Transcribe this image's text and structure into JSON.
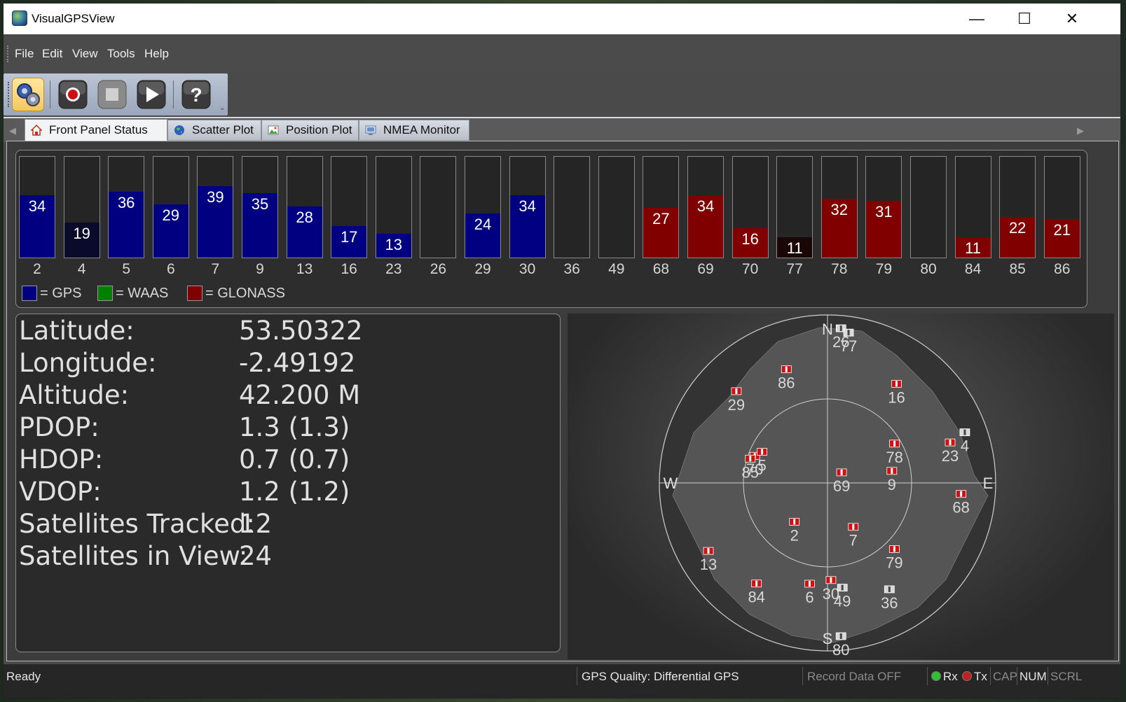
{
  "window": {
    "title": "VisualGPSView",
    "minimize": "—",
    "maximize": "☐",
    "close": "✕"
  },
  "menu": [
    "File",
    "Edit",
    "View",
    "Tools",
    "Help"
  ],
  "toolbar": {
    "settings": "settings",
    "record": "record",
    "stop": "stop",
    "play": "play",
    "help": "?"
  },
  "tabs": [
    {
      "label": "Front Panel Status",
      "icon": "home-icon"
    },
    {
      "label": "Scatter Plot",
      "icon": "globe-icon"
    },
    {
      "label": "Position Plot",
      "icon": "picture-icon"
    },
    {
      "label": "NMEA Monitor",
      "icon": "monitor-icon"
    }
  ],
  "colors": {
    "gps": "#000080",
    "waas": "#008000",
    "glonass": "#800000",
    "gps_weak": "#0a0a2a",
    "glonass_weak": "#1a0606"
  },
  "snr": {
    "scale_max": 55,
    "bars": [
      {
        "prn": "2",
        "snr": 34,
        "system": "gps"
      },
      {
        "prn": "4",
        "snr": 19,
        "system": "gps_weak"
      },
      {
        "prn": "5",
        "snr": 36,
        "system": "gps"
      },
      {
        "prn": "6",
        "snr": 29,
        "system": "gps"
      },
      {
        "prn": "7",
        "snr": 39,
        "system": "gps"
      },
      {
        "prn": "9",
        "snr": 35,
        "system": "gps"
      },
      {
        "prn": "13",
        "snr": 28,
        "system": "gps"
      },
      {
        "prn": "16",
        "snr": 17,
        "system": "gps"
      },
      {
        "prn": "23",
        "snr": 13,
        "system": "gps"
      },
      {
        "prn": "26",
        "snr": null,
        "system": "none"
      },
      {
        "prn": "29",
        "snr": 24,
        "system": "gps"
      },
      {
        "prn": "30",
        "snr": 34,
        "system": "gps"
      },
      {
        "prn": "36",
        "snr": null,
        "system": "none"
      },
      {
        "prn": "49",
        "snr": null,
        "system": "none"
      },
      {
        "prn": "68",
        "snr": 27,
        "system": "glonass"
      },
      {
        "prn": "69",
        "snr": 34,
        "system": "glonass"
      },
      {
        "prn": "70",
        "snr": 16,
        "system": "glonass"
      },
      {
        "prn": "77",
        "snr": 11,
        "system": "glonass_weak"
      },
      {
        "prn": "78",
        "snr": 32,
        "system": "glonass"
      },
      {
        "prn": "79",
        "snr": 31,
        "system": "glonass"
      },
      {
        "prn": "80",
        "snr": null,
        "system": "none"
      },
      {
        "prn": "84",
        "snr": 11,
        "system": "glonass"
      },
      {
        "prn": "85",
        "snr": 22,
        "system": "glonass"
      },
      {
        "prn": "86",
        "snr": 21,
        "system": "glonass"
      }
    ],
    "legend": [
      {
        "label": "= GPS",
        "color": "#000080"
      },
      {
        "label": "= WAAS",
        "color": "#008000"
      },
      {
        "label": "= GLONASS",
        "color": "#800000"
      }
    ]
  },
  "info": [
    {
      "label": "Latitude:",
      "value": "53.50322"
    },
    {
      "label": "Longitude:",
      "value": "-2.49192"
    },
    {
      "label": "Altitude:",
      "value": "42.200 M"
    },
    {
      "label": "PDOP:",
      "value": "1.3 (1.3)"
    },
    {
      "label": "HDOP:",
      "value": "0.7 (0.7)"
    },
    {
      "label": "VDOP:",
      "value": "1.2 (1.2)"
    },
    {
      "label": "Satellites Tracked:",
      "value": "12"
    },
    {
      "label": "Satellites in View:",
      "value": "24"
    }
  ],
  "skyplot": {
    "directions": {
      "n": "N",
      "s": "S",
      "e": "E",
      "w": "W"
    },
    "satellites": [
      {
        "prn": "26",
        "az": 5,
        "el": 0,
        "used": false
      },
      {
        "prn": "77",
        "az": 8,
        "el": 2,
        "used": false
      },
      {
        "prn": "86",
        "az": 340,
        "el": 20,
        "used": true
      },
      {
        "prn": "16",
        "az": 35,
        "el": 20,
        "used": true
      },
      {
        "prn": "29",
        "az": 315,
        "el": 15,
        "used": true
      },
      {
        "prn": "78",
        "az": 60,
        "el": 45,
        "used": true
      },
      {
        "prn": "4",
        "az": 70,
        "el": 5,
        "used": false
      },
      {
        "prn": "23",
        "az": 72,
        "el": 15,
        "used": true
      },
      {
        "prn": "70",
        "az": 290,
        "el": 45,
        "used": true
      },
      {
        "prn": "5",
        "az": 295,
        "el": 48,
        "used": true
      },
      {
        "prn": "85",
        "az": 287,
        "el": 43,
        "used": true
      },
      {
        "prn": "69",
        "az": 55,
        "el": 80,
        "used": true
      },
      {
        "prn": "9",
        "az": 80,
        "el": 52,
        "used": true
      },
      {
        "prn": "68",
        "az": 95,
        "el": 12,
        "used": true
      },
      {
        "prn": "2",
        "az": 220,
        "el": 60,
        "used": true
      },
      {
        "prn": "7",
        "az": 150,
        "el": 60,
        "used": true
      },
      {
        "prn": "79",
        "az": 135,
        "el": 35,
        "used": true
      },
      {
        "prn": "13",
        "az": 240,
        "el": 10,
        "used": true
      },
      {
        "prn": "84",
        "az": 215,
        "el": 18,
        "used": true
      },
      {
        "prn": "6",
        "az": 190,
        "el": 30,
        "used": true
      },
      {
        "prn": "30",
        "az": 178,
        "el": 33,
        "used": true
      },
      {
        "prn": "49",
        "az": 172,
        "el": 28,
        "used": false
      },
      {
        "prn": "36",
        "az": 150,
        "el": 18,
        "used": false
      },
      {
        "prn": "80",
        "az": 175,
        "el": 0,
        "used": false
      }
    ]
  },
  "status": {
    "ready": "Ready",
    "quality": "GPS Quality: Differential GPS",
    "record": "Record Data OFF",
    "rx": "Rx",
    "tx": "Tx",
    "cap": "CAP",
    "num": "NUM",
    "scrl": "SCRL"
  }
}
